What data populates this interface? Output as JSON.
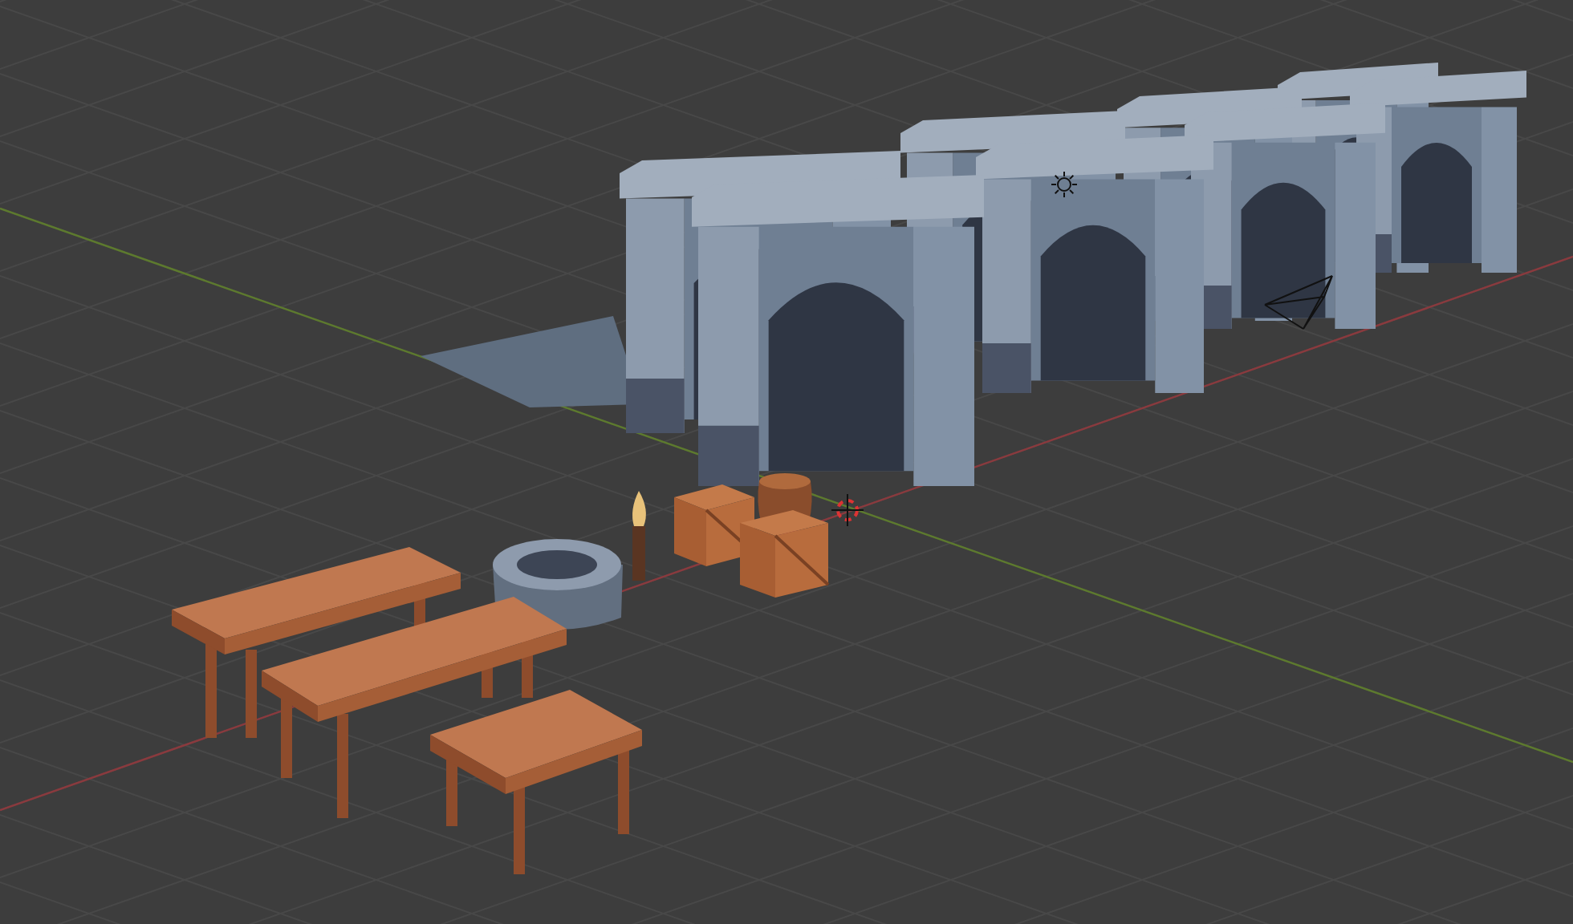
{
  "viewport": {
    "kind": "perspective"
  }
}
